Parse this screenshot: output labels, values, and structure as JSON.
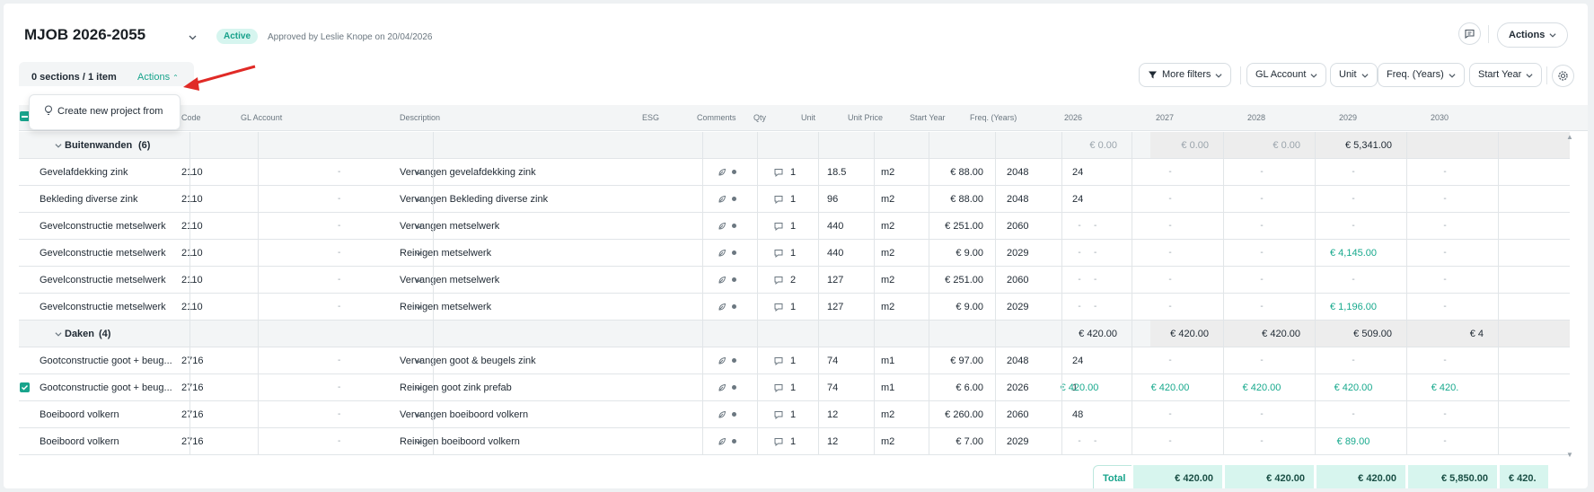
{
  "header": {
    "title": "MJOB 2026-2055",
    "status": "Active",
    "approved": "Approved by Leslie Knope on 20/04/2026",
    "actions_label": "Actions"
  },
  "toolbar": {
    "sections_count": "0 sections / 1 item",
    "actions_label": "Actions",
    "dropdown_item": "Create new project from",
    "filters": [
      "More filters",
      "GL Account",
      "Unit",
      "Freq. (Years)",
      "Start Year"
    ]
  },
  "columns": [
    "Code",
    "GL Account",
    "Description",
    "ESG",
    "Comments",
    "Qty",
    "Unit",
    "Unit Price",
    "Start Year",
    "Freq. (Years)",
    "2026",
    "2027",
    "2028",
    "2029",
    "2030"
  ],
  "groups": [
    {
      "name": "Buitenwanden",
      "count": "(6)",
      "year_totals": [
        "€ 0.00",
        "€ 0.00",
        "€ 0.00",
        "€ 5,341.00",
        ""
      ],
      "rows": [
        {
          "name": "Gevelafdekking zink",
          "code": "2110",
          "gl": "-",
          "desc": "Vervangen gevelafdekking zink",
          "comments": "1",
          "qty": "18.5",
          "unit": "m2",
          "price": "€ 88.00",
          "start": "2048",
          "freq": "24",
          "years": [
            "-",
            "-",
            "-",
            "-",
            "-"
          ]
        },
        {
          "name": "Bekleding diverse zink",
          "code": "2110",
          "gl": "-",
          "desc": "Vervangen Bekleding diverse zink",
          "comments": "1",
          "qty": "96",
          "unit": "m2",
          "price": "€ 88.00",
          "start": "2048",
          "freq": "24",
          "years": [
            "-",
            "-",
            "-",
            "-",
            "-"
          ]
        },
        {
          "name": "Gevelconstructie metselwerk",
          "code": "2110",
          "gl": "-",
          "desc": "Vervangen metselwerk",
          "comments": "1",
          "qty": "440",
          "unit": "m2",
          "price": "€ 251.00",
          "start": "2060",
          "freq": "-",
          "years": [
            "-",
            "-",
            "-",
            "-",
            "-"
          ]
        },
        {
          "name": "Gevelconstructie metselwerk",
          "code": "2110",
          "gl": "-",
          "desc": "Reinigen metselwerk",
          "comments": "1",
          "qty": "440",
          "unit": "m2",
          "price": "€ 9.00",
          "start": "2029",
          "freq": "-",
          "years": [
            "-",
            "-",
            "-",
            "€ 4,145.00",
            "-"
          ]
        },
        {
          "name": "Gevelconstructie metselwerk",
          "code": "2110",
          "gl": "-",
          "desc": "Vervangen metselwerk",
          "comments": "2",
          "qty": "127",
          "unit": "m2",
          "price": "€ 251.00",
          "start": "2060",
          "freq": "-",
          "years": [
            "-",
            "-",
            "-",
            "-",
            "-"
          ]
        },
        {
          "name": "Gevelconstructie metselwerk",
          "code": "2110",
          "gl": "-",
          "desc": "Reinigen metselwerk",
          "comments": "1",
          "qty": "127",
          "unit": "m2",
          "price": "€ 9.00",
          "start": "2029",
          "freq": "-",
          "years": [
            "-",
            "-",
            "-",
            "€ 1,196.00",
            "-"
          ]
        }
      ]
    },
    {
      "name": "Daken",
      "count": "(4)",
      "year_totals": [
        "€ 420.00",
        "€ 420.00",
        "€ 420.00",
        "€ 509.00",
        "€ 4"
      ],
      "rows": [
        {
          "name": "Gootconstructie goot + beug...",
          "code": "2716",
          "gl": "-",
          "desc": "Vervangen goot & beugels zink",
          "comments": "1",
          "qty": "74",
          "unit": "m1",
          "price": "€ 97.00",
          "start": "2048",
          "freq": "24",
          "years": [
            "-",
            "-",
            "-",
            "-",
            "-"
          ]
        },
        {
          "name": "Gootconstructie goot + beug...",
          "code": "2716",
          "gl": "-",
          "desc": "Reinigen goot zink prefab",
          "comments": "1",
          "qty": "74",
          "unit": "m1",
          "price": "€ 6.00",
          "start": "2026",
          "freq": "1",
          "years": [
            "€ 420.00",
            "€ 420.00",
            "€ 420.00",
            "€ 420.00",
            "€ 420."
          ]
        },
        {
          "name": "Boeiboord volkern",
          "code": "2716",
          "gl": "-",
          "desc": "Vervangen boeiboord volkern",
          "comments": "1",
          "qty": "12",
          "unit": "m2",
          "price": "€ 260.00",
          "start": "2060",
          "freq": "48",
          "years": [
            "-",
            "-",
            "-",
            "-",
            "-"
          ]
        },
        {
          "name": "Boeiboord volkern",
          "code": "2716",
          "gl": "-",
          "desc": "Reinigen boeiboord volkern",
          "comments": "1",
          "qty": "12",
          "unit": "m2",
          "price": "€ 7.00",
          "start": "2029",
          "freq": "-",
          "years": [
            "-",
            "-",
            "-",
            "€ 89.00",
            "-"
          ]
        }
      ]
    }
  ],
  "totals": {
    "label": "Total",
    "values": [
      "€ 420.00",
      "€ 420.00",
      "€ 420.00",
      "€ 5,850.00",
      "€ 420."
    ]
  },
  "colors": {
    "accent": "#18a48c",
    "arrow": "#e02a26"
  }
}
